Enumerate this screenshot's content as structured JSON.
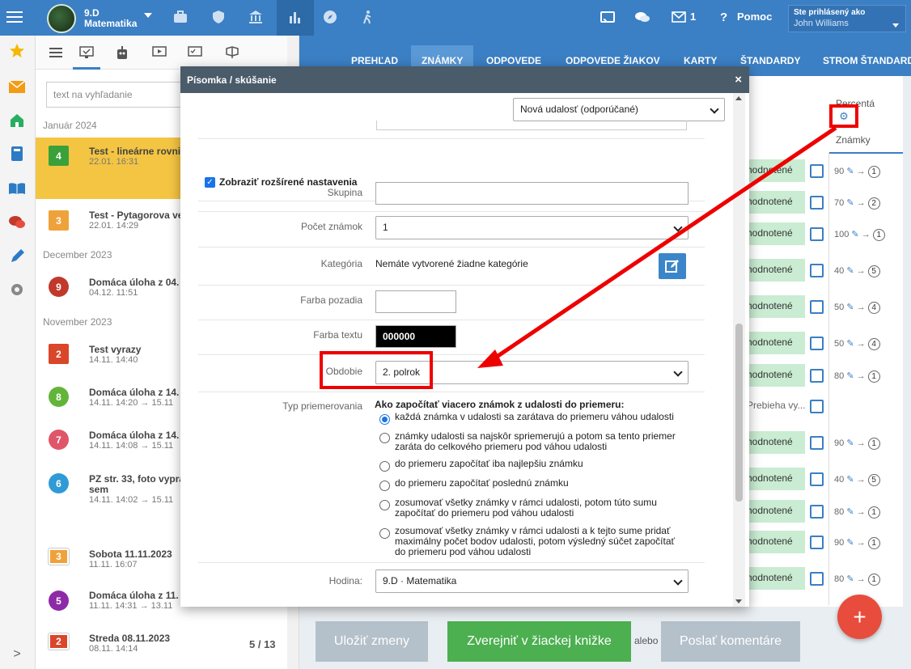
{
  "topbar": {
    "class_name": "9.D",
    "class_subject": "Matematika",
    "icons": [
      "briefcase-icon",
      "shield-icon",
      "bank-icon",
      "chart-icon",
      "compass-icon",
      "hiker-icon"
    ],
    "cast_icon": "cast-icon",
    "chat_icon": "chat-icon",
    "mail_count": "1",
    "help_label": "Pomoc",
    "user_label": "Ste prihlásený ako",
    "user_name": "John Williams"
  },
  "rail": {
    "icons": [
      "star-icon",
      "mail-icon",
      "home-icon",
      "book-icon",
      "open-book-icon",
      "chat-bubbles-icon",
      "pen-icon",
      "gear-icon"
    ],
    "collapse_icon": ">"
  },
  "panel": {
    "search_placeholder": "text na vyhľadanie",
    "pager": "5 / 13",
    "months": [
      "Január 2024",
      "December 2023",
      "November 2023"
    ],
    "events": [
      {
        "badge": "4",
        "color": "#3aa13a",
        "title": "Test - lineárne rovni",
        "date": "22.01. 16:31",
        "selected": true
      },
      {
        "badge": "3",
        "color": "#f0a23a",
        "title": "Test - Pytagorova ve",
        "date": "22.01. 14:29"
      },
      {
        "badge": "9",
        "color": "#c0392b",
        "title": "Domáca úloha z 04.",
        "date": "04.12. 11:51"
      },
      {
        "badge": "2",
        "color": "#d9462a",
        "title": "Test vyrazy",
        "date": "14.11. 14:40"
      },
      {
        "badge": "8",
        "color": "#62b53a",
        "title": "Domáca úloha z 14.",
        "date": "14.11. 14:20 → 15.11"
      },
      {
        "badge": "7",
        "color": "#e0556a",
        "title": "Domáca úloha z 14.",
        "date": "14.11. 14:08 → 15.11"
      },
      {
        "badge": "6",
        "color": "#2e9bd6",
        "title": "PZ str. 33, foto vypra",
        "title2": "sem",
        "date": "14.11. 14:02 → 15.11"
      },
      {
        "badge": "3",
        "color": "#f0a23a",
        "title": "Sobota 11.11.2023",
        "date": "11.11. 16:07",
        "square": true
      },
      {
        "badge": "5",
        "color": "#8e2aa8",
        "title": "Domáca úloha z 11.",
        "date": "11.11. 14:31 → 13.11"
      },
      {
        "badge": "2",
        "color": "#d9462a",
        "title": "Streda 08.11.2023",
        "date": "08.11. 14:14",
        "square": true
      }
    ]
  },
  "tabs": [
    "PREHĽAD",
    "ZNÁMKY",
    "ODPOVEDE",
    "ODPOVEDE ŽIAKOV",
    "KARTY",
    "ŠTANDARDY",
    "STROM ŠTANDARDOV"
  ],
  "grid": {
    "percent_header": "Percentá",
    "grades_header": "Známky",
    "rows": [
      {
        "status": "hodnotené",
        "perc": "90",
        "grade": "1"
      },
      {
        "status": "hodnotené",
        "perc": "70",
        "grade": "2"
      },
      {
        "status": "hodnotené",
        "perc": "100",
        "grade": "1"
      },
      {
        "status": "hodnotené",
        "perc": "40",
        "grade": "5"
      },
      {
        "status": "hodnotené",
        "perc": "50",
        "grade": "4"
      },
      {
        "status": "hodnotené",
        "perc": "50",
        "grade": "4"
      },
      {
        "status": "hodnotené",
        "perc": "80",
        "grade": "1"
      },
      {
        "status": "Prebieha vy...",
        "perc": "",
        "grade": ""
      },
      {
        "status": "hodnotené",
        "perc": "90",
        "grade": "1"
      },
      {
        "status": "hodnotené",
        "perc": "40",
        "grade": "5"
      },
      {
        "status": "hodnotené",
        "perc": "80",
        "grade": "1"
      },
      {
        "status": "hodnotené",
        "perc": "90",
        "grade": "1"
      },
      {
        "status": "hodnotené",
        "perc": "80",
        "grade": "1"
      }
    ]
  },
  "buttons": {
    "save": "Uložiť zmeny",
    "publish": "Zverejniť v žiackej knižke",
    "or": "alebo",
    "comment": "Poslať komentáre",
    "fab": "+"
  },
  "modal": {
    "title": "Písomka / skúšanie",
    "close": "×",
    "event_type": "Nová udalosť (odporúčané)",
    "show_advanced": "Zobraziť rozšírené nastavenia",
    "group_label": "Skupina",
    "group_value": "",
    "count_label": "Počet známok",
    "count_value": "1",
    "category_label": "Kategória",
    "category_value": "Nemáte vytvorené žiadne kategórie",
    "bg_label": "Farba pozadia",
    "text_label": "Farba textu",
    "text_color_value": "000000",
    "period_label": "Obdobie",
    "period_value": "2. polrok",
    "avg_label": "Typ priemerovania",
    "avg_question": "Ako započítať viacero známok z udalosti do priemeru:",
    "avg_options": [
      "každá známka v udalosti sa zarátava do priemeru váhou udalosti",
      "známky udalosti sa najskôr spriemerujú a potom sa tento priemer zaráta do celkového priemeru pod váhou udalosti",
      "do priemeru započítať iba najlepšiu známku",
      "do priemeru započítať poslednú známku",
      "zosumovať všetky známky v rámci udalosti, potom túto sumu započítať do priemeru pod váhou udalosti",
      "zosumovať všetky známky v rámci udalosti a k tejto sume pridať maximálny počet bodov udalosti, potom výsledný súčet započítať do priemeru pod váhou udalosti"
    ],
    "lesson_label": "Hodina:",
    "lesson_value": "9.D · Matematika"
  },
  "colors": {
    "brand": "#3b7fc4",
    "selected": "#f4c542",
    "save_button": "#aebbc5",
    "publish_button": "#4caf50",
    "annotation": "#e00000"
  }
}
